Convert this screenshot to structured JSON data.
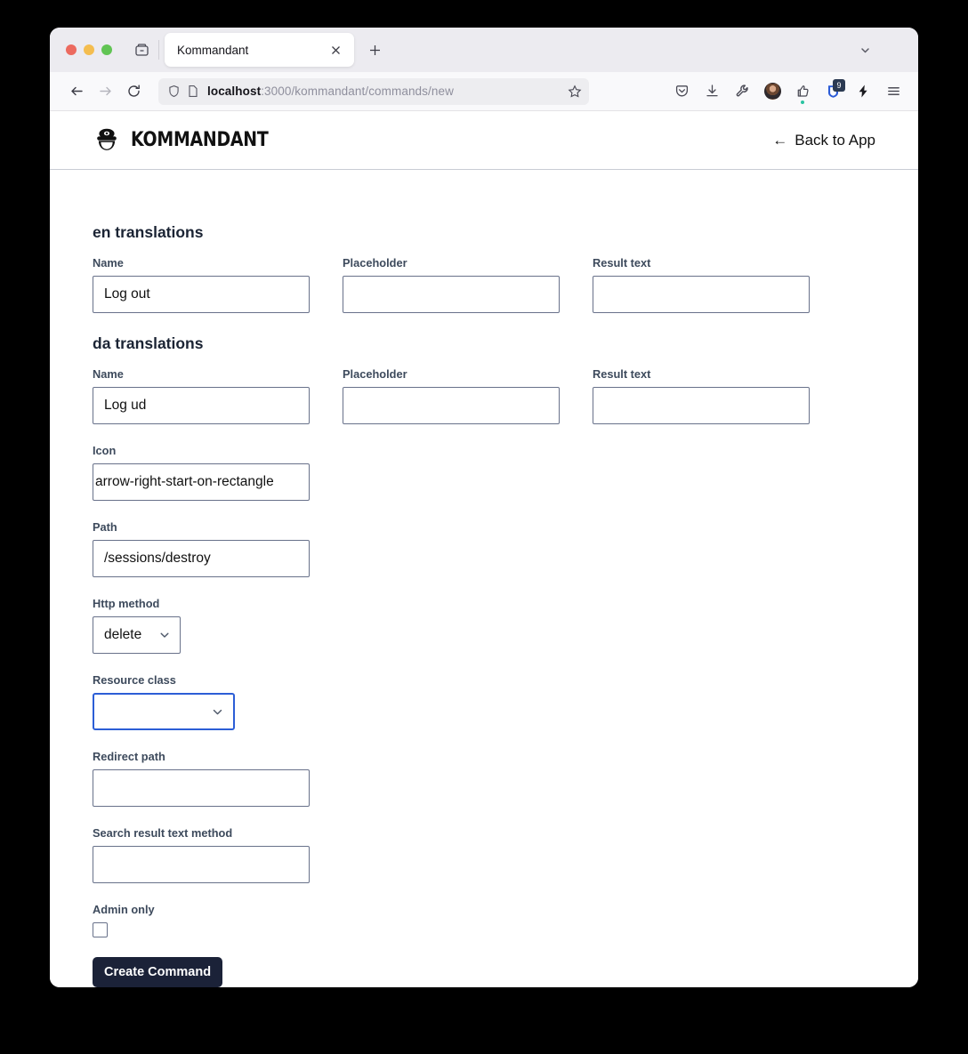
{
  "browser": {
    "tab": {
      "title": "Kommandant",
      "close_icon": "close-icon"
    },
    "newtab_label": "+",
    "url": {
      "host": "localhost",
      "rest": ":3000/kommandant/commands/new"
    },
    "extensions": {
      "shield_badge": "9"
    }
  },
  "site": {
    "brand": "KOMMANDANT",
    "back_link": "Back to App",
    "back_arrow": "←"
  },
  "form": {
    "sections": [
      {
        "title": "en translations",
        "fields": [
          {
            "label": "Name",
            "value": "Log out"
          },
          {
            "label": "Placeholder",
            "value": ""
          },
          {
            "label": "Result text",
            "value": ""
          }
        ]
      },
      {
        "title": "da translations",
        "fields": [
          {
            "label": "Name",
            "value": "Log ud"
          },
          {
            "label": "Placeholder",
            "value": ""
          },
          {
            "label": "Result text",
            "value": ""
          }
        ]
      }
    ],
    "icon_field": {
      "label": "Icon",
      "value": "arrow-right-start-on-rectangle"
    },
    "path_field": {
      "label": "Path",
      "value": "/sessions/destroy"
    },
    "http_method": {
      "label": "Http method",
      "value": "delete"
    },
    "resource_class": {
      "label": "Resource class",
      "value": ""
    },
    "redirect_path": {
      "label": "Redirect path",
      "value": ""
    },
    "search_result_text_method": {
      "label": "Search result text method",
      "value": ""
    },
    "admin_only": {
      "label": "Admin only",
      "checked": false
    },
    "submit_label": "Create Command"
  },
  "colors": {
    "accent_focus": "#2c5ed6",
    "button_bg": "#1b2238",
    "label": "#3d4a5c",
    "border": "#68718a"
  }
}
